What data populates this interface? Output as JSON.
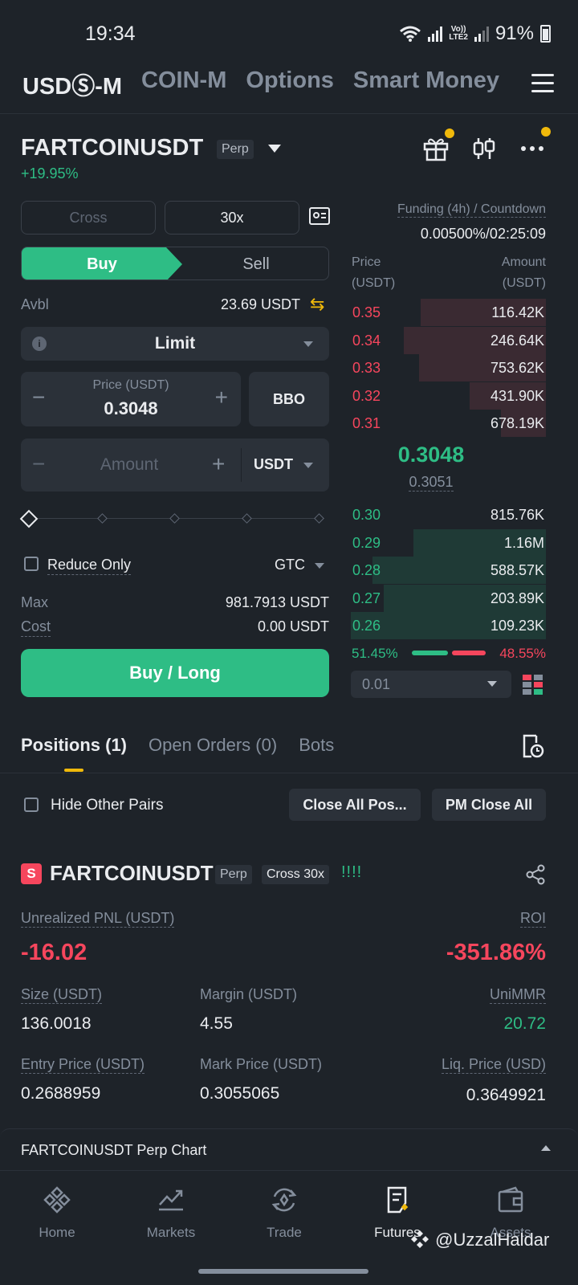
{
  "status": {
    "time": "19:34",
    "volte_top": "Vo))",
    "volte_bottom": "LTE2",
    "battery": "91%"
  },
  "top_tabs": [
    "USDⓈ-M",
    "COIN-M",
    "Options",
    "Smart Money"
  ],
  "header": {
    "symbol": "FARTCOINUSDT",
    "tag": "Perp",
    "change": "+19.95%"
  },
  "form": {
    "margin_mode": "Cross",
    "leverage": "30x",
    "buy_label": "Buy",
    "sell_label": "Sell",
    "avbl_label": "Avbl",
    "avbl_value": "23.69 USDT",
    "order_type": "Limit",
    "price_label": "Price (USDT)",
    "price_value": "0.3048",
    "bbo_label": "BBO",
    "amount_placeholder": "Amount",
    "amount_unit": "USDT",
    "slider_percent": 0,
    "reduce_only_label": "Reduce Only",
    "tif": "GTC",
    "max_label": "Max",
    "max_value": "981.7913 USDT",
    "cost_label": "Cost",
    "cost_value": "0.00 USDT",
    "submit_label": "Buy / Long"
  },
  "orderbook": {
    "funding_label": "Funding (4h) / Countdown",
    "funding_value": "0.00500%/02:25:09",
    "price_header_1": "Price",
    "price_header_2": "(USDT)",
    "amount_header_1": "Amount",
    "amount_header_2": "(USDT)",
    "asks": [
      {
        "price": "0.35",
        "amount": "116.42K",
        "depth": 0.64
      },
      {
        "price": "0.34",
        "amount": "246.64K",
        "depth": 0.73
      },
      {
        "price": "0.33",
        "amount": "753.62K",
        "depth": 0.65
      },
      {
        "price": "0.32",
        "amount": "431.90K",
        "depth": 0.39
      },
      {
        "price": "0.31",
        "amount": "678.19K",
        "depth": 0.23
      }
    ],
    "mid_price": "0.3048",
    "mark_price": "0.3051",
    "bids": [
      {
        "price": "0.30",
        "amount": "815.76K",
        "depth": 0.0
      },
      {
        "price": "0.29",
        "amount": "1.16M",
        "depth": 0.68
      },
      {
        "price": "0.28",
        "amount": "588.57K",
        "depth": 0.89
      },
      {
        "price": "0.27",
        "amount": "203.89K",
        "depth": 0.83
      },
      {
        "price": "0.26",
        "amount": "109.23K",
        "depth": 1.0
      }
    ],
    "buy_ratio": "51.45%",
    "sell_ratio": "48.55%",
    "depth_step": "0.01"
  },
  "positions": {
    "tabs": [
      "Positions (1)",
      "Open Orders (0)",
      "Bots"
    ],
    "hide_label": "Hide Other Pairs",
    "close_all_label": "Close All Pos...",
    "pm_close_label": "PM Close All",
    "item": {
      "side_badge": "S",
      "symbol": "FARTCOINUSDT",
      "tag": "Perp",
      "mode": "Cross 30x",
      "bangs": "!!!!",
      "upnl_label": "Unrealized PNL (USDT)",
      "upnl_value": "-16.02",
      "roi_label": "ROI",
      "roi_value": "-351.86%",
      "size_label": "Size (USDT)",
      "size_value": "136.0018",
      "margin_label": "Margin (USDT)",
      "margin_value": "4.55",
      "unimmr_label": "UniMMR",
      "unimmr_value": "20.72",
      "entry_label": "Entry Price (USDT)",
      "entry_value": "0.2688959",
      "mark_label": "Mark Price (USDT)",
      "mark_value": "0.3055065",
      "liq_label": "Liq. Price (USD)",
      "liq_value": "0.3649921"
    }
  },
  "chart_bar": {
    "title": "FARTCOINUSDT Perp Chart"
  },
  "nav": [
    "Home",
    "Markets",
    "Trade",
    "Futures",
    "Assets"
  ],
  "watermark": "@UzzalHaldar",
  "colors": {
    "green": "#2ebd85",
    "red": "#f6465d",
    "yellow": "#f0b90b",
    "bg": "#1e2329"
  }
}
